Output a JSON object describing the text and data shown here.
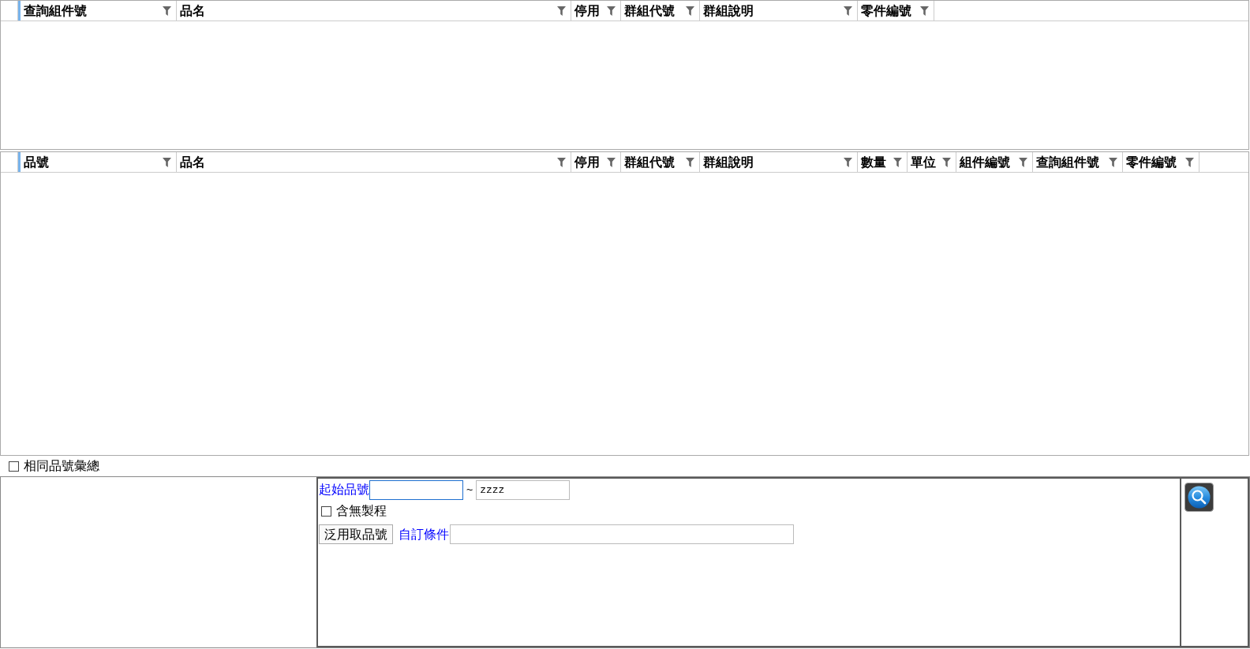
{
  "grids": [
    {
      "columns": [
        {
          "label": "查詢組件號"
        },
        {
          "label": "品名"
        },
        {
          "label": "停用"
        },
        {
          "label": "群組代號"
        },
        {
          "label": "群組說明"
        },
        {
          "label": "零件編號"
        }
      ]
    },
    {
      "columns": [
        {
          "label": "品號"
        },
        {
          "label": "品名"
        },
        {
          "label": "停用"
        },
        {
          "label": "群組代號"
        },
        {
          "label": "群組說明"
        },
        {
          "label": "數量"
        },
        {
          "label": "單位"
        },
        {
          "label": "組件編號"
        },
        {
          "label": "查詢組件號"
        },
        {
          "label": "零件編號"
        }
      ]
    }
  ],
  "summary_option": {
    "label": "相同品號彙總",
    "checked": false
  },
  "query_form": {
    "start_item": {
      "label": "起始品號",
      "focused": true
    },
    "range_separator": "~",
    "end_item": {
      "value": "zzzz"
    },
    "no_process_option": {
      "label": "含無製程",
      "checked": false
    },
    "generic_button": {
      "label": "泛用取品號"
    },
    "custom_condition": {
      "label": "自訂條件"
    }
  }
}
